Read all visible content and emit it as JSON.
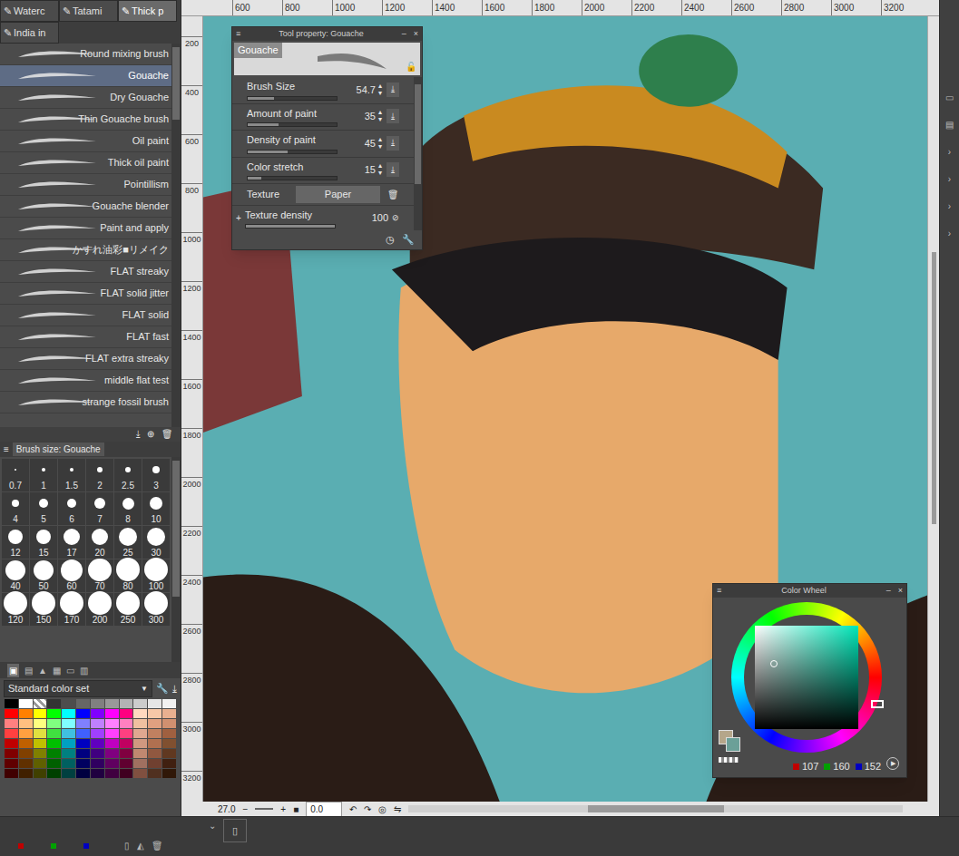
{
  "brush_tabs": [
    {
      "label": "Waterc",
      "selected": false
    },
    {
      "label": "Tatami",
      "selected": false
    },
    {
      "label": "Thick p",
      "selected": true
    },
    {
      "label": "India in",
      "selected": false
    }
  ],
  "brushes": [
    {
      "name": "Round mixing brush",
      "selected": false
    },
    {
      "name": "Gouache",
      "selected": true
    },
    {
      "name": "Dry Gouache",
      "selected": false
    },
    {
      "name": "Thin Gouache brush",
      "selected": false
    },
    {
      "name": "Oil paint",
      "selected": false
    },
    {
      "name": "Thick oil paint",
      "selected": false
    },
    {
      "name": "Pointillism",
      "selected": false
    },
    {
      "name": "Gouache blender",
      "selected": false
    },
    {
      "name": "Paint and apply",
      "selected": false
    },
    {
      "name": "かすれ油彩■リメイク",
      "selected": false
    },
    {
      "name": "FLAT streaky",
      "selected": false
    },
    {
      "name": "FLAT solid jitter",
      "selected": false
    },
    {
      "name": "FLAT solid",
      "selected": false
    },
    {
      "name": "FLAT fast",
      "selected": false
    },
    {
      "name": "FLAT extra streaky",
      "selected": false
    },
    {
      "name": "middle flat test",
      "selected": false
    },
    {
      "name": "strange fossil brush",
      "selected": false
    }
  ],
  "brush_size_panel": {
    "title": "Brush size: Gouache",
    "sizes": [
      "0.7",
      "1",
      "1.5",
      "2",
      "2.5",
      "3",
      "4",
      "5",
      "6",
      "7",
      "8",
      "10",
      "12",
      "15",
      "17",
      "20",
      "25",
      "30",
      "40",
      "50",
      "60",
      "70",
      "80",
      "100",
      "120",
      "150",
      "170",
      "200",
      "250",
      "300"
    ]
  },
  "color_set": {
    "dropdown": "Standard color set",
    "swatches": [
      "#000000",
      "#ffffff",
      "transparent",
      "#333333",
      "#4d4d4d",
      "#666666",
      "#808080",
      "#999999",
      "#b3b3b3",
      "#cccccc",
      "#e6e6e6",
      "#f2f2f2",
      "#ff0000",
      "#ff8000",
      "#ffff00",
      "#00ff00",
      "#00ffff",
      "#0000ff",
      "#8000ff",
      "#ff00ff",
      "#ff0080",
      "#ffd9c0",
      "#f7c8a8",
      "#e8b090",
      "#ff8080",
      "#ffc080",
      "#ffff80",
      "#80ff80",
      "#80ffff",
      "#8080ff",
      "#c080ff",
      "#ff80ff",
      "#ff80c0",
      "#f0c0a0",
      "#e0a080",
      "#d09070",
      "#ff4040",
      "#ffa040",
      "#e0e040",
      "#40e040",
      "#40c0e0",
      "#4060ff",
      "#a040ff",
      "#ff40ff",
      "#ff4080",
      "#e0a890",
      "#c08060",
      "#a06040",
      "#c00000",
      "#c06000",
      "#c0c000",
      "#00c000",
      "#00a0c0",
      "#0000c0",
      "#6000c0",
      "#c000c0",
      "#c00060",
      "#d09880",
      "#b07050",
      "#805030",
      "#800000",
      "#804000",
      "#808000",
      "#008000",
      "#008080",
      "#000080",
      "#400080",
      "#800080",
      "#800040",
      "#c08870",
      "#905840",
      "#603820",
      "#600000",
      "#603000",
      "#606000",
      "#006000",
      "#006060",
      "#000060",
      "#300060",
      "#600060",
      "#600030",
      "#a07060",
      "#704030",
      "#402010",
      "#400000",
      "#402000",
      "#404000",
      "#004000",
      "#004040",
      "#000040",
      "#200040",
      "#400040",
      "#400020",
      "#805040",
      "#503020",
      "#301808"
    ]
  },
  "rulers": {
    "top": [
      "600",
      "800",
      "1000",
      "1200",
      "1400",
      "1600",
      "1800",
      "2000",
      "2200",
      "2400",
      "2600",
      "2800",
      "3000",
      "3200"
    ],
    "left": [
      "200",
      "400",
      "600",
      "800",
      "1000",
      "1200",
      "1400",
      "1600",
      "1800",
      "2000",
      "2200",
      "2400",
      "2600",
      "2800",
      "3000",
      "3200"
    ]
  },
  "status_bar": {
    "zoom": "27.0",
    "angle": "0.0"
  },
  "tool_property": {
    "title": "Tool property: Gouache",
    "preview_label": "Gouache",
    "rows": [
      {
        "label": "Brush Size",
        "value": "54.7",
        "level": 0.3
      },
      {
        "label": "Amount of paint",
        "value": "35",
        "level": 0.35
      },
      {
        "label": "Density of paint",
        "value": "45",
        "level": 0.45
      },
      {
        "label": "Color stretch",
        "value": "15",
        "level": 0.15
      }
    ],
    "texture": {
      "label": "Texture",
      "value": "Paper"
    },
    "texture_density": {
      "label": "Texture density",
      "value": "100",
      "level": 1
    }
  },
  "color_wheel": {
    "title": "Color Wheel",
    "rgb": [
      {
        "value": "107",
        "color": "#c00000"
      },
      {
        "value": "160",
        "color": "#00a000"
      },
      {
        "value": "152",
        "color": "#0000c0"
      }
    ],
    "main_color": "#6ba098",
    "sub_color": "#b5a68a",
    "hue_color": "#00e6b8",
    "saturation": 0.18,
    "brightness": 0.63
  },
  "bottom_rgb": [
    {
      "color": "#c00000"
    },
    {
      "color": "#00a000"
    },
    {
      "color": "#0000c0"
    }
  ]
}
